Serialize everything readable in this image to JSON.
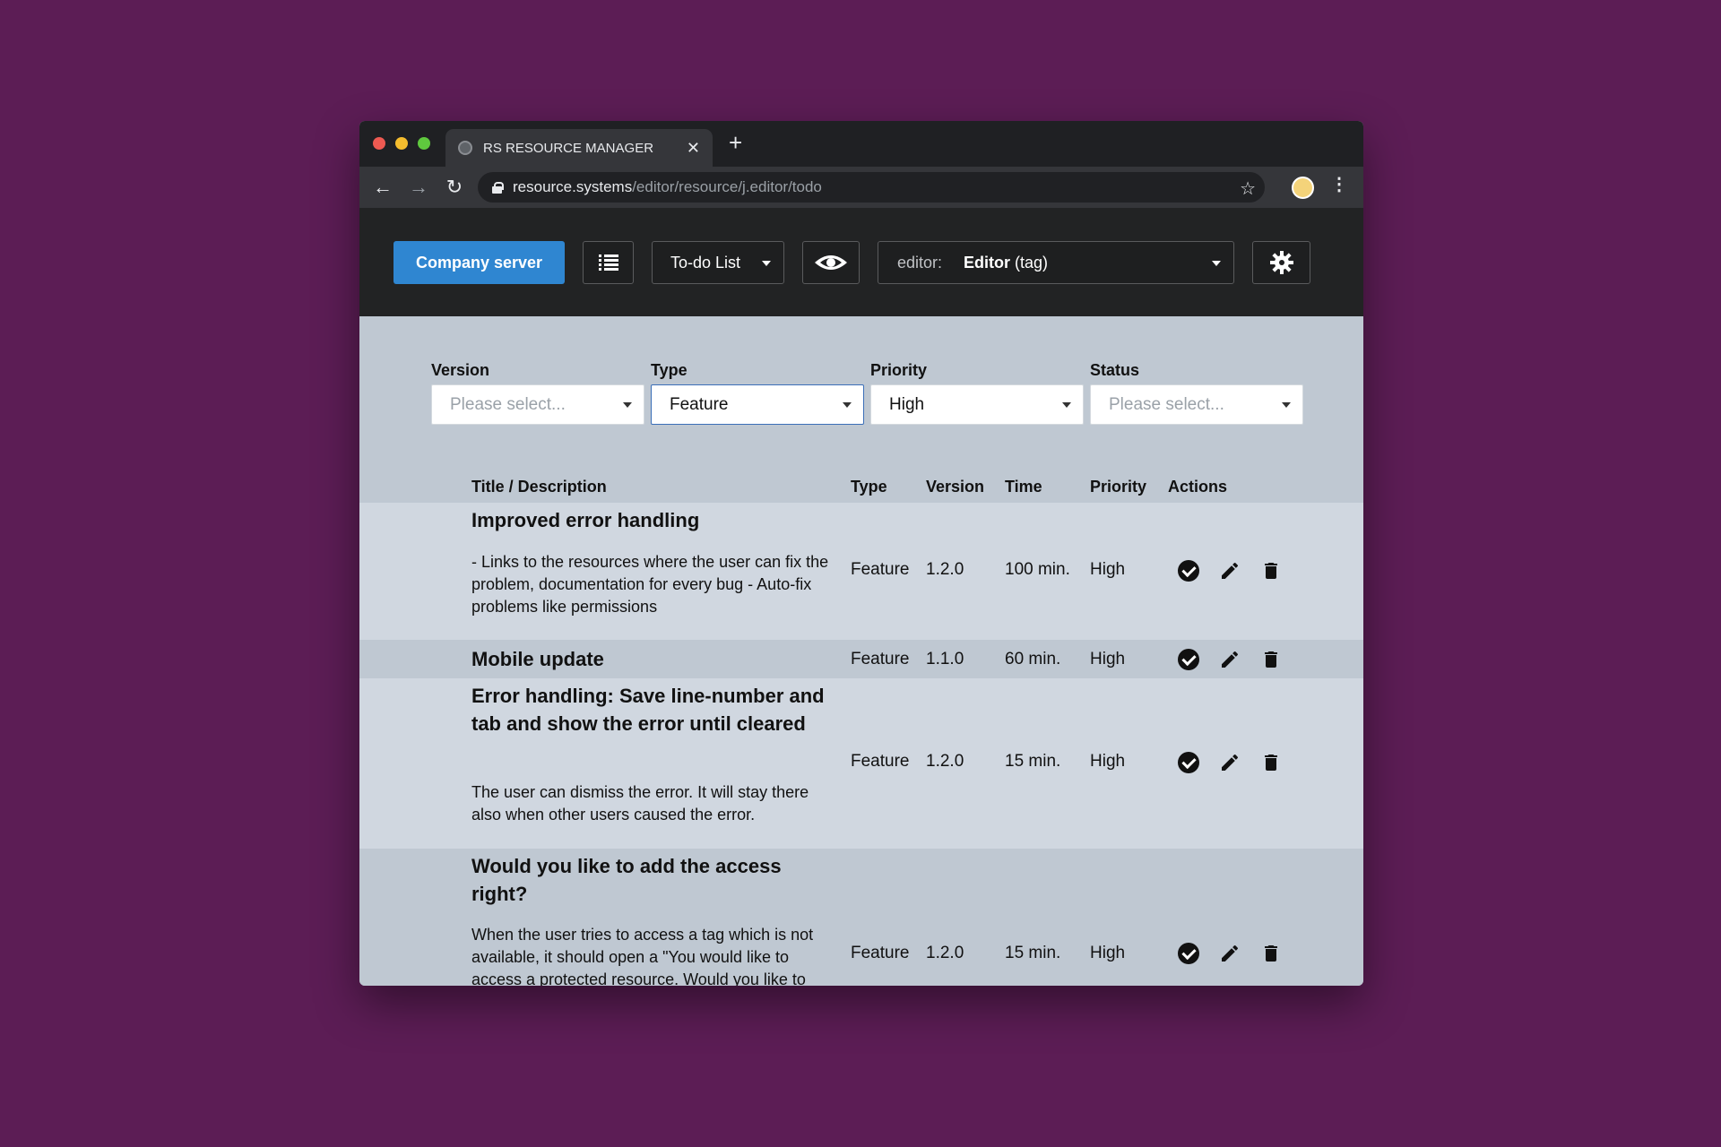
{
  "browser": {
    "tab_title": "RS RESOURCE MANAGER",
    "url_host": "resource.systems",
    "url_path": "/editor/resource/j.editor/todo"
  },
  "header": {
    "server_button": "Company server",
    "view_select": "To-do List",
    "editor_prefix": "editor:",
    "editor_value": "Editor",
    "editor_suffix": "(tag)"
  },
  "filters": [
    {
      "label": "Version",
      "value": "",
      "placeholder": "Please select..."
    },
    {
      "label": "Type",
      "value": "Feature",
      "placeholder": ""
    },
    {
      "label": "Priority",
      "value": "High",
      "placeholder": ""
    },
    {
      "label": "Status",
      "value": "",
      "placeholder": "Please select..."
    }
  ],
  "table": {
    "columns": [
      "Title / Description",
      "Type",
      "Version",
      "Time",
      "Priority",
      "Actions"
    ],
    "rows": [
      {
        "title": "Improved error handling",
        "description": "- Links to the resources where the user can fix the problem, documentation for every bug - Auto-fix problems like permissions",
        "type": "Feature",
        "version": "1.2.0",
        "time": "100 min.",
        "priority": "High"
      },
      {
        "title": "Mobile update",
        "description": "",
        "type": "Feature",
        "version": "1.1.0",
        "time": "60 min.",
        "priority": "High"
      },
      {
        "title": "Error handling: Save line-number and tab and show the error until cleared",
        "description": "The user can dismiss the error. It will stay there also when other users caused the error.",
        "type": "Feature",
        "version": "1.2.0",
        "time": "15 min.",
        "priority": "High"
      },
      {
        "title": "Would you like to add the access right?",
        "description": "When the user tries to access a tag which is not available, it should open a \"You would like to access a protected resource. Would you like to",
        "type": "Feature",
        "version": "1.2.0",
        "time": "15 min.",
        "priority": "High"
      }
    ]
  }
}
